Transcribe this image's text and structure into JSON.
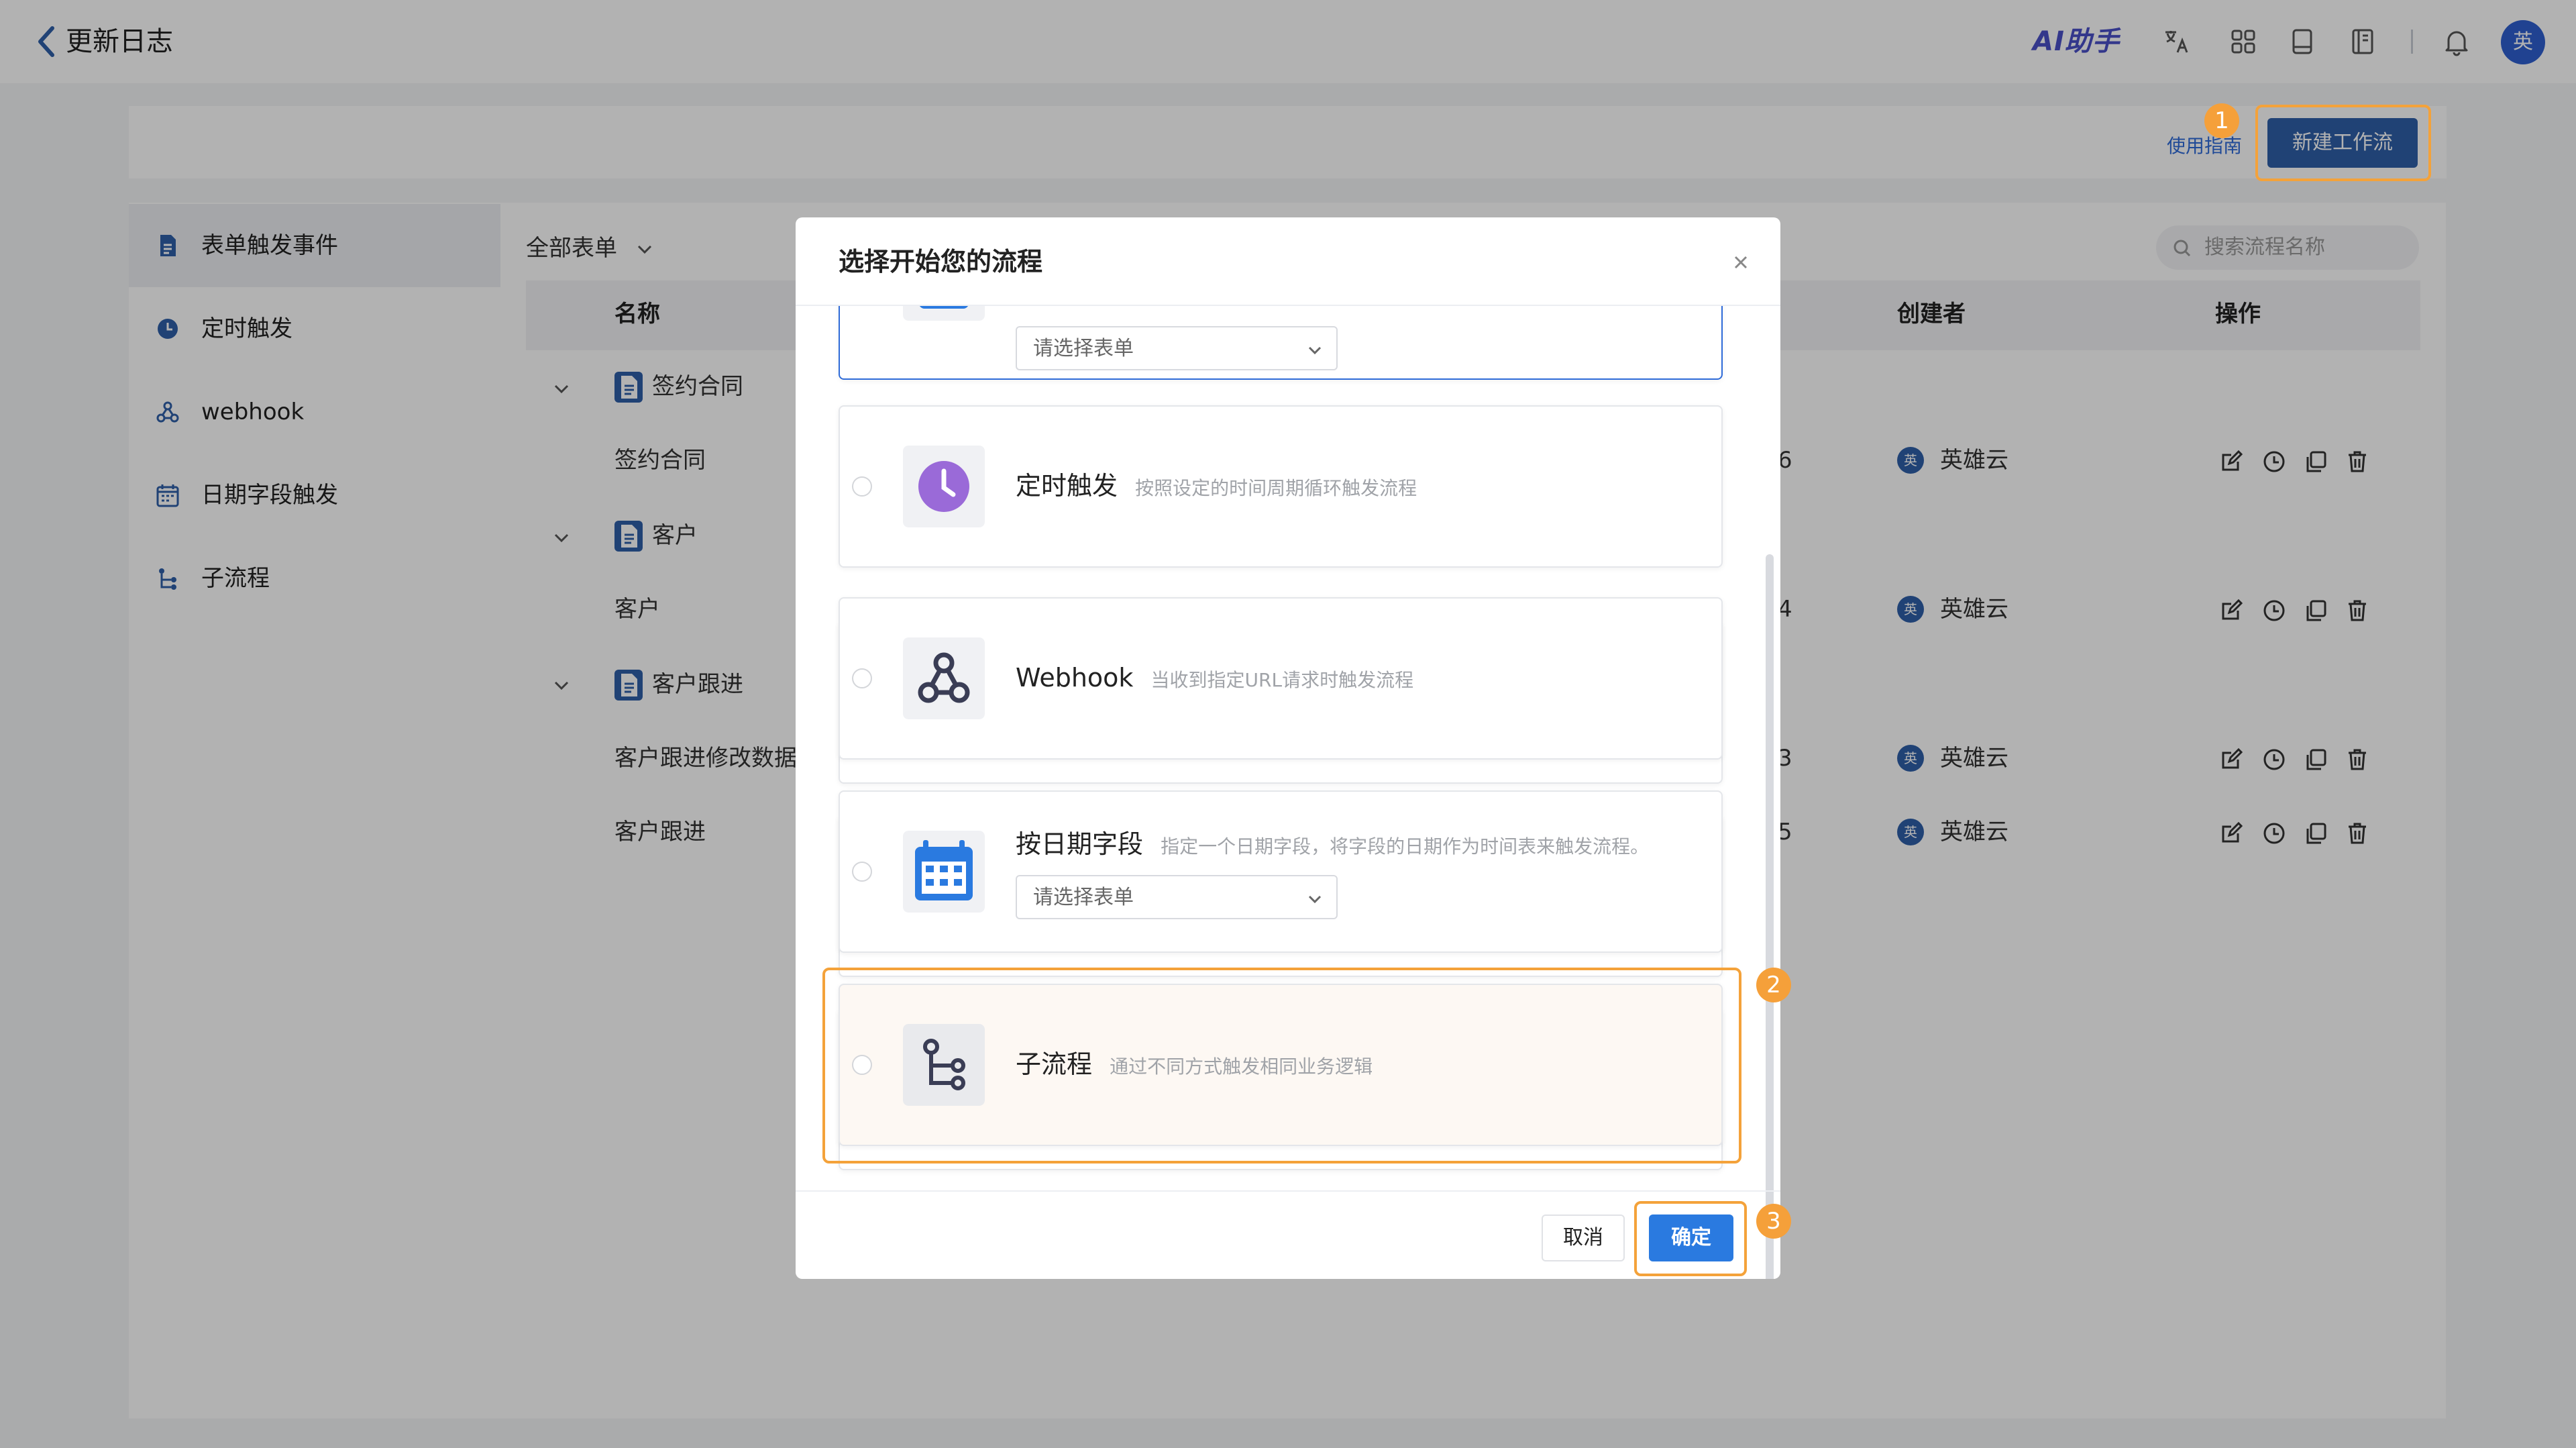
{
  "topbar": {
    "title": "更新日志",
    "ai_assistant": "AI助手",
    "avatar_text": "英",
    "icons": [
      "translate-icon",
      "apps-icon",
      "tablet-icon",
      "book-icon",
      "bell-icon"
    ]
  },
  "header": {
    "guide_link": "使用指南",
    "new_workflow": "新建工作流"
  },
  "steps": [
    "1",
    "2",
    "3"
  ],
  "sidebar": {
    "items": [
      {
        "label": "表单触发事件",
        "icon": "form-icon",
        "active": true
      },
      {
        "label": "定时触发",
        "icon": "clock-icon",
        "active": false
      },
      {
        "label": "webhook",
        "icon": "webhook-icon",
        "active": false
      },
      {
        "label": "日期字段触发",
        "icon": "calendar-icon",
        "active": false
      },
      {
        "label": "子流程",
        "icon": "subflow-icon",
        "active": false
      }
    ]
  },
  "main": {
    "filter_label": "全部表单",
    "search_placeholder": "搜索流程名称",
    "columns": {
      "name": "名称",
      "creator": "创建者",
      "actions": "操作"
    },
    "groups": [
      {
        "name": "签约合同",
        "rows": [
          {
            "name": "签约合同",
            "date_suffix": "6",
            "creator": "英雄云",
            "creator_avatar": "英"
          }
        ]
      },
      {
        "name": "客户",
        "rows": [
          {
            "name": "客户",
            "date_suffix": "4",
            "creator": "英雄云",
            "creator_avatar": "英"
          }
        ]
      },
      {
        "name": "客户跟进",
        "rows": [
          {
            "name": "客户跟进修改数据",
            "date_suffix": "3",
            "creator": "英雄云",
            "creator_avatar": "英"
          },
          {
            "name": "客户跟进",
            "date_suffix": "5",
            "creator": "英雄云",
            "creator_avatar": "英"
          }
        ]
      }
    ]
  },
  "modal": {
    "title": "选择开始您的流程",
    "cards": [
      {
        "title": "",
        "desc": "",
        "select_placeholder": "请选择表单",
        "icon": "form-icon"
      },
      {
        "title": "定时触发",
        "desc": "按照设定的时间周期循环触发流程",
        "icon": "clock-icon"
      },
      {
        "title": "Webhook",
        "desc": "当收到指定URL请求时触发流程",
        "icon": "webhook-icon"
      },
      {
        "title": "按日期字段",
        "desc": "指定一个日期字段，将字段的日期作为时间表来触发流程。",
        "select_placeholder": "请选择表单",
        "icon": "calendar-icon"
      },
      {
        "title": "子流程",
        "desc": "通过不同方式触发相同业务逻辑",
        "icon": "subflow-icon"
      }
    ],
    "cancel": "取消",
    "confirm": "确定"
  },
  "colors": {
    "brand_blue": "#2f5fa8",
    "primary_button": "#2a7ae0",
    "highlight_orange": "#f4a23a",
    "ai_purple": "#4a50c8"
  }
}
